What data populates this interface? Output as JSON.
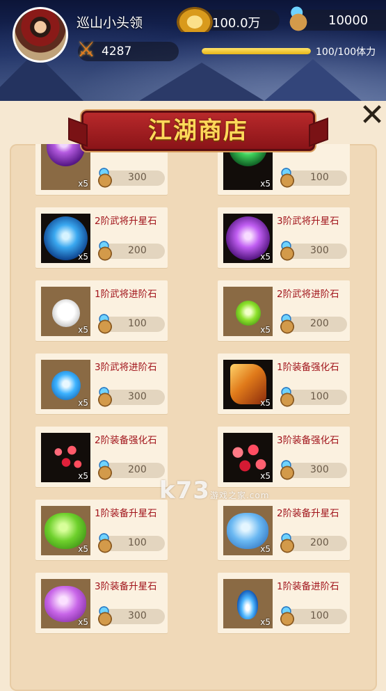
{
  "player": {
    "name": "巡山小头领",
    "power": "4287",
    "gold": "100.0万",
    "gems": "10000",
    "stamina_text": "100/100体力",
    "stamina_fraction": 1.0
  },
  "shop": {
    "title": "江湖商店",
    "close_icon": "close-icon",
    "items": [
      {
        "name": "",
        "qty": "x5",
        "price": "300",
        "art": "purple-orb-partial"
      },
      {
        "name": "",
        "qty": "x5",
        "price": "100",
        "art": "green-orb-partial"
      },
      {
        "name": "2阶武将升星石",
        "qty": "x5",
        "price": "200",
        "art": "blue-orb"
      },
      {
        "name": "3阶武将升星石",
        "qty": "x5",
        "price": "300",
        "art": "purple-orb"
      },
      {
        "name": "1阶武将进阶石",
        "qty": "x5",
        "price": "100",
        "art": "white-orb"
      },
      {
        "name": "2阶武将进阶石",
        "qty": "x5",
        "price": "200",
        "art": "green-small-orb"
      },
      {
        "name": "3阶武将进阶石",
        "qty": "x5",
        "price": "300",
        "art": "blue-small-orb"
      },
      {
        "name": "1阶装备强化石",
        "qty": "x5",
        "price": "100",
        "art": "orange-crystal"
      },
      {
        "name": "2阶装备强化石",
        "qty": "x5",
        "price": "200",
        "art": "red-shards"
      },
      {
        "name": "3阶装备强化石",
        "qty": "x5",
        "price": "300",
        "art": "red-shards-2"
      },
      {
        "name": "1阶装备升星石",
        "qty": "x5",
        "price": "100",
        "art": "green-gem"
      },
      {
        "name": "2阶装备升星石",
        "qty": "x5",
        "price": "200",
        "art": "blue-gem"
      },
      {
        "name": "3阶装备升星石",
        "qty": "x5",
        "price": "300",
        "art": "purple-gem"
      },
      {
        "name": "1阶装备进阶石",
        "qty": "x5",
        "price": "100",
        "art": "blue-flame"
      }
    ]
  },
  "watermark": {
    "main": "k73",
    "sub": "游戏之家",
    "domain": ".com"
  }
}
